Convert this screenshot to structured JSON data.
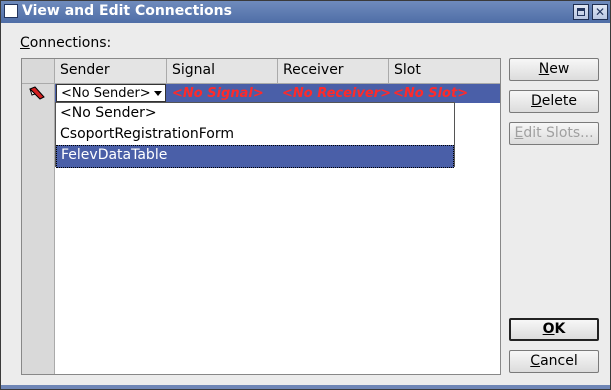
{
  "window": {
    "title": "View and Edit Connections"
  },
  "connections_label": "Connections:",
  "table": {
    "columns": [
      "Sender",
      "Signal",
      "Receiver",
      "Slot"
    ],
    "row": {
      "sender": "<No Sender>",
      "signal": "<No Signal>",
      "receiver": "<No Receiver>",
      "slot": "<No Slot>"
    }
  },
  "dropdown": {
    "items": [
      "<No Sender>",
      "CsoportRegistrationForm",
      "FelevDataTable"
    ],
    "selected_index": 2
  },
  "buttons": {
    "new": "New",
    "delete": "Delete",
    "edit_slots": "Edit Slots...",
    "ok": "OK",
    "cancel": "Cancel"
  },
  "colors": {
    "selection": "#4a5fa8",
    "warning_text": "#ff2a2a",
    "titlebar": "#5a78b0"
  },
  "icons": {
    "row_marker": "pencil-red-icon"
  }
}
